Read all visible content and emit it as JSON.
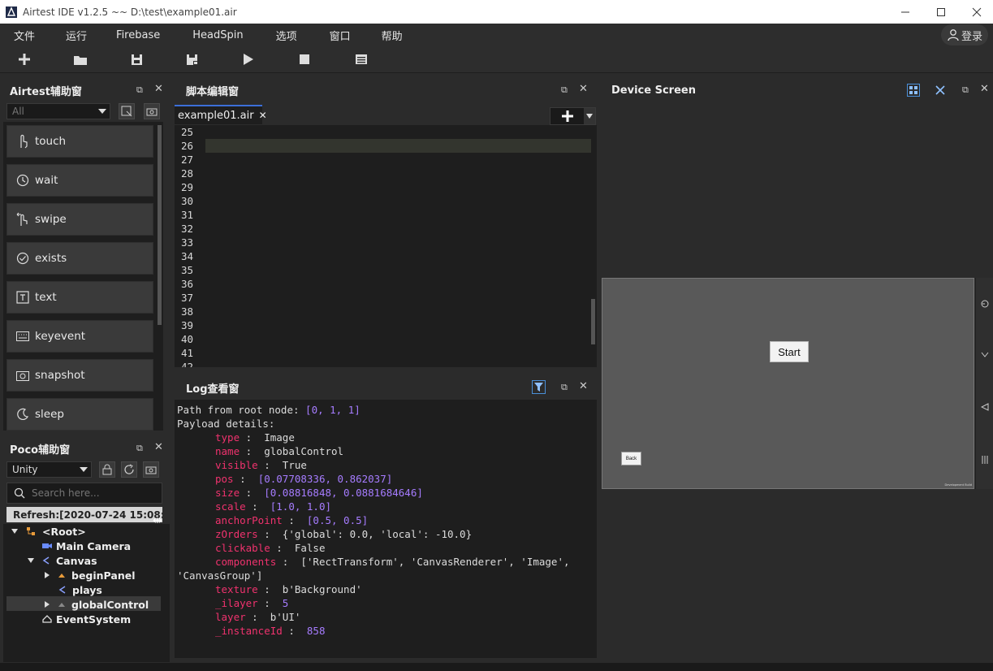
{
  "window": {
    "title": "Airtest IDE v1.2.5 ~~ D:\\test\\example01.air"
  },
  "menu": [
    "文件",
    "运行",
    "Firebase",
    "HeadSpin",
    "选项",
    "窗口",
    "帮助"
  ],
  "login_label": "登录",
  "airtest_panel": {
    "title": "Airtest辅助窗",
    "filter_value": "All",
    "buttons": [
      "touch",
      "wait",
      "swipe",
      "exists",
      "text",
      "keyevent",
      "snapshot",
      "sleep"
    ]
  },
  "poco_panel": {
    "title": "Poco辅助窗",
    "mode_value": "Unity",
    "search_placeholder": "Search here...",
    "refresh_label": "Refresh:[2020-07-24 15:08:49]",
    "tree": [
      {
        "label": "<Root>"
      },
      {
        "label": "Main Camera"
      },
      {
        "label": "Canvas"
      },
      {
        "label": "beginPanel"
      },
      {
        "label": "plays"
      },
      {
        "label": "globalControl"
      },
      {
        "label": "EventSystem"
      }
    ]
  },
  "editor": {
    "title": "脚本编辑窗",
    "tab": "example01.air",
    "line_numbers": [
      "25",
      "26",
      "27",
      "28",
      "29",
      "30",
      "31",
      "32",
      "33",
      "34",
      "35",
      "36",
      "37",
      "38",
      "39",
      "40",
      "41",
      "42"
    ]
  },
  "log_panel": {
    "title": "Log查看窗",
    "path_line": "Path from root node: ",
    "path_value": "[0, 1, 1]",
    "payload_line": "Payload details:",
    "fields": [
      {
        "key": "type",
        "value": "Image"
      },
      {
        "key": "name",
        "value": "globalControl"
      },
      {
        "key": "visible",
        "value": "True"
      },
      {
        "key": "pos",
        "value": "[0.07708336, 0.862037]"
      },
      {
        "key": "size",
        "value": "[0.08816848, 0.0881684646]"
      },
      {
        "key": "scale",
        "value": "[1.0, 1.0]"
      },
      {
        "key": "anchorPoint",
        "value": "[0.5, 0.5]"
      },
      {
        "key": "zOrders",
        "value": "{'global': 0.0, 'local': -10.0}"
      },
      {
        "key": "clickable",
        "value": "False"
      },
      {
        "key": "components",
        "value": "['RectTransform', 'CanvasRenderer', 'Image',"
      },
      {
        "key": "",
        "value": "'CanvasGroup']"
      },
      {
        "key": "texture",
        "value": "b'Background'"
      },
      {
        "key": "_ilayer",
        "value": "5"
      },
      {
        "key": "layer",
        "value": "b'UI'"
      },
      {
        "key": "_instanceId",
        "value": "858"
      }
    ]
  },
  "device": {
    "title": "Device Screen",
    "start_label": "Start",
    "back_label": "Back",
    "dev_label": "Development Build"
  }
}
